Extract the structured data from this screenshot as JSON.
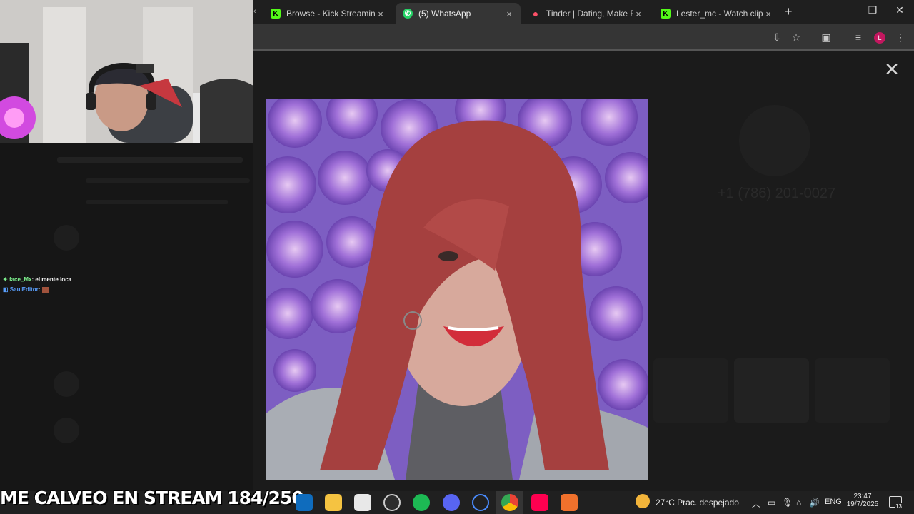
{
  "browser": {
    "tabs": [
      {
        "title": "Browse - Kick Streaming",
        "favicon": "kick-icon",
        "color": "#53fc18",
        "active": false
      },
      {
        "title": "(5) WhatsApp",
        "favicon": "whatsapp-icon",
        "color": "#25d366",
        "active": true
      },
      {
        "title": "Tinder | Dating, Make Frien",
        "favicon": "tinder-icon",
        "color": "#fd5068",
        "active": false
      },
      {
        "title": "Lester_mc - Watch clips on",
        "favicon": "kick-icon",
        "color": "#53fc18",
        "active": false
      }
    ],
    "new_tab": "+",
    "tab_close": "×",
    "profile_initial": "L"
  },
  "viewer": {
    "close": "✕",
    "background_contact": {
      "phone": "+1 (786) 201-0027"
    }
  },
  "stream_chat": [
    {
      "user": "face_Mx",
      "user_color": "#7df08d",
      "message": ": el mente loca"
    },
    {
      "user": "SaulEditor",
      "user_color": "#5aa0ff",
      "message": ":"
    }
  ],
  "stream_banner": "ME CALVEO EN STREAM 184/250",
  "taskbar": {
    "weather": "27°C  Prac. despejado",
    "language": "ENG",
    "time": "23:47",
    "date": "19/7/2025",
    "notifications": "13"
  }
}
